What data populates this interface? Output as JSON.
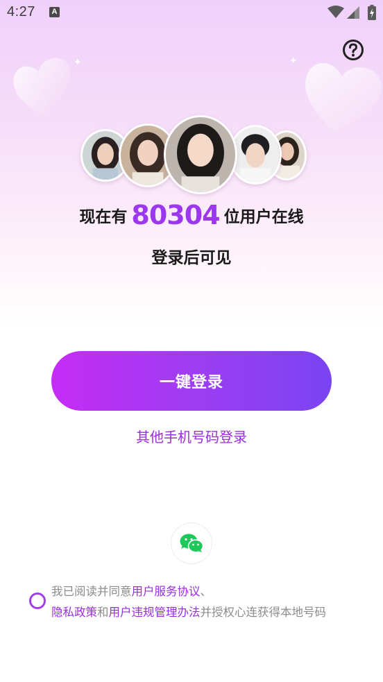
{
  "status_bar": {
    "time": "4:27",
    "notification_icon_letter": "A"
  },
  "main": {
    "online_prefix": "现在有",
    "online_count": "80304",
    "online_suffix": "位用户在线",
    "login_hint": "登录后可见",
    "one_click_login": "一键登录",
    "other_phone_login": "其他手机号码登录"
  },
  "agreement": {
    "prefix": "我已阅读并同意",
    "user_service_agreement": "用户服务协议",
    "separator": "、",
    "privacy_policy": "隐私政策",
    "conjunction": "和",
    "violation_rules": "用户违规管理办法",
    "suffix": "并授权心连获得本地号码"
  },
  "icons": {
    "help": "help-circle-icon",
    "wechat": "wechat-icon"
  },
  "colors": {
    "accent": "#9b37ee",
    "gradient_start": "#c52cf5",
    "gradient_end": "#7a44f1",
    "link": "#9a2de0",
    "wechat_green": "#1fc85a"
  }
}
